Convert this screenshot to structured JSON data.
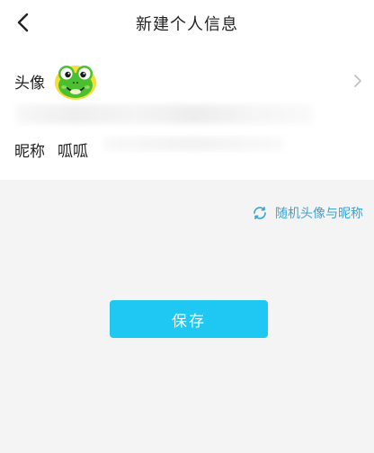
{
  "header": {
    "title": "新建个人信息",
    "back_icon": "chevron-left-icon"
  },
  "profile": {
    "avatar_label": "头像",
    "avatar_icon": "frog-avatar-icon",
    "nickname_label": "昵称",
    "nickname_value": "呱呱",
    "chevron_icon": "chevron-right-icon"
  },
  "actions": {
    "random_label": "随机头像与昵称",
    "random_icon": "refresh-icon",
    "save_label": "保存"
  },
  "colors": {
    "accent": "#1fc8f3",
    "link": "#3aa3d8",
    "background": "#f4f4f4",
    "panel": "#ffffff"
  }
}
